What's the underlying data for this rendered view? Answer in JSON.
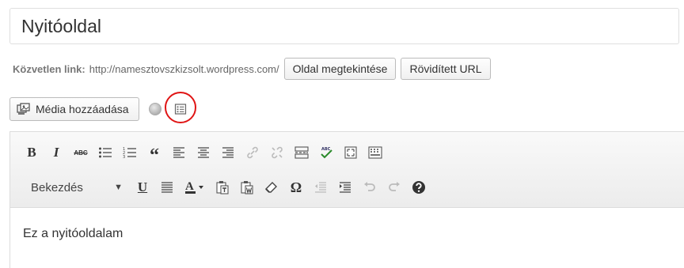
{
  "title": {
    "value": "Nyitóoldal"
  },
  "permalink": {
    "label": "Közvetlen link:",
    "url": "http://namesztovszkizsolt.wordpress.com/",
    "view_button": "Oldal megtekintése",
    "shortlink_button": "Rövidített URL"
  },
  "media": {
    "add_button": "Média hozzáadása"
  },
  "toolbar": {
    "row1": [
      "bold-icon",
      "italic-icon",
      "strikethrough-icon",
      "bullet-list-icon",
      "numbered-list-icon",
      "blockquote-icon",
      "align-left-icon",
      "align-center-icon",
      "align-right-icon",
      "link-icon",
      "unlink-icon",
      "more-tag-icon",
      "spellcheck-icon",
      "fullscreen-icon",
      "kitchen-sink-icon"
    ],
    "format_select": "Bekezdés",
    "row2": [
      "underline-icon",
      "justify-icon",
      "text-color-icon",
      "paste-text-icon",
      "paste-word-icon",
      "clear-format-icon",
      "special-char-icon",
      "outdent-icon",
      "indent-icon",
      "undo-icon",
      "redo-icon",
      "help-icon"
    ],
    "bold_glyph": "B",
    "italic_glyph": "I",
    "strike_glyph": "ABC",
    "quote_glyph": "“",
    "underline_glyph": "U",
    "color_glyph": "A",
    "omega_glyph": "Ω",
    "abc_glyph": "ABC"
  },
  "editor": {
    "content": "Ez a nyitóoldalam"
  },
  "colors": {
    "accent_red": "#e01515"
  }
}
